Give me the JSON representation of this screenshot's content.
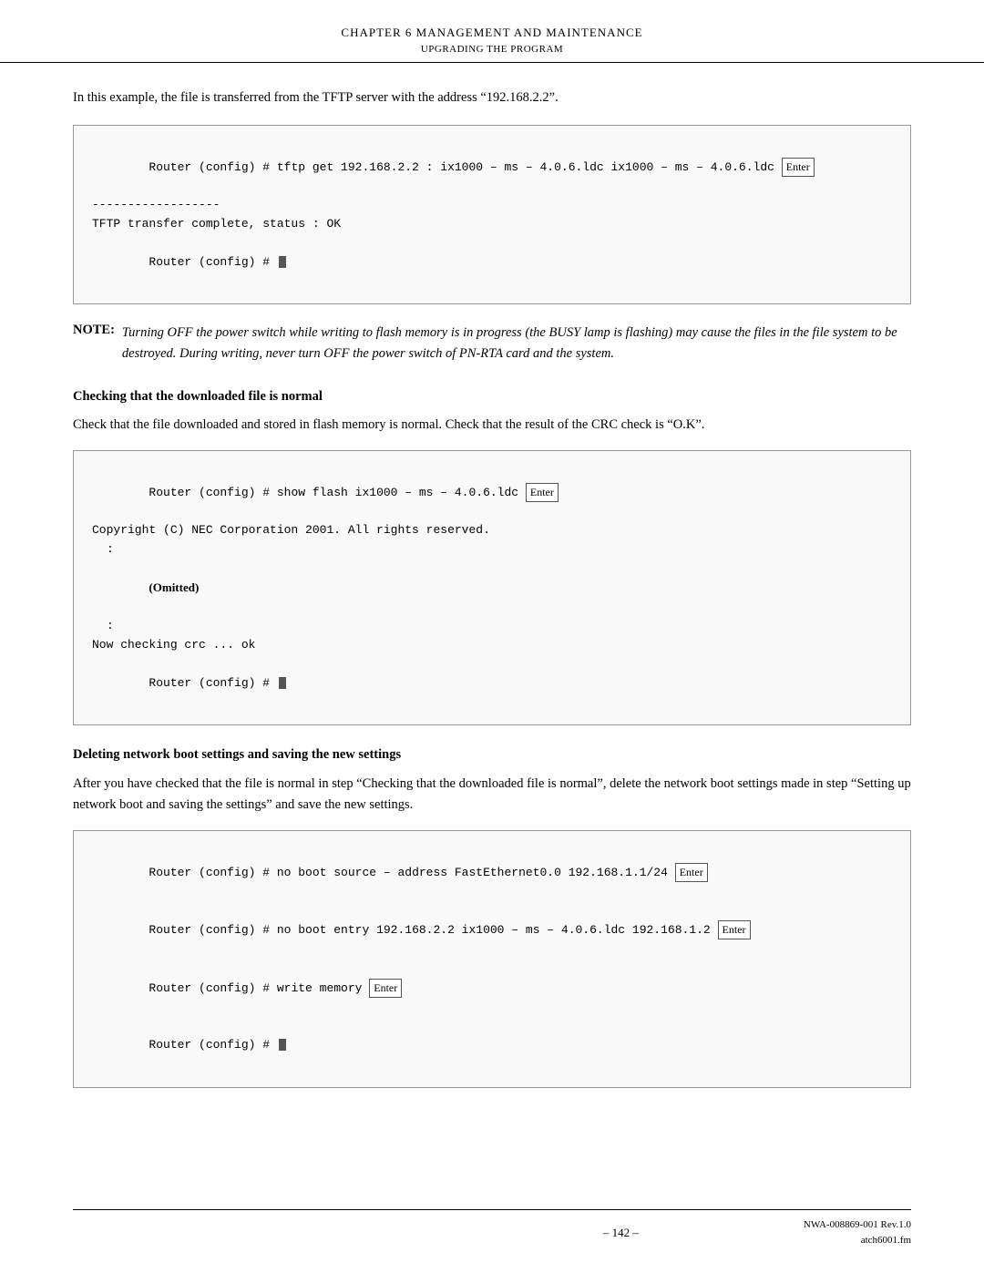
{
  "header": {
    "chapter": "CHAPTER 6   MANAGEMENT AND MAINTENANCE",
    "subtitle": "UPGRADING THE PROGRAM",
    "rule": true
  },
  "intro": {
    "text": "In this example, the file is transferred from the TFTP server with the address “192.168.2.2”."
  },
  "code_block_1": {
    "line1": "Router (config) # tftp get 192.168.2.2 : ix1000 – ms – 4.0.6.ldc ix1000 – ms – 4.0.6.ldc ",
    "enter1": "Enter",
    "line2": "------------------",
    "line3": "TFTP transfer complete, status : OK",
    "line4": "Router (config) # "
  },
  "note": {
    "label": "NOTE:",
    "text": "Turning OFF the power switch while writing to flash memory is in progress (the BUSY lamp is flashing) may cause the files in the file system to be destroyed. During writing, never turn OFF the power switch of PN-RTA card and the system."
  },
  "section1": {
    "heading": "Checking that the downloaded file is normal",
    "body": "Check that the file downloaded and stored in flash memory is normal. Check that the result of the CRC check is “O.K”."
  },
  "code_block_2": {
    "line1": "Router (config) # show flash ix1000 – ms – 4.0.6.ldc ",
    "enter1": "Enter",
    "line2": "Copyright (C) NEC Corporation 2001. All rights reserved.",
    "colon1": ":",
    "omitted": "(Omitted)",
    "colon2": ":",
    "line3": "Now checking crc ... ok",
    "line4": "Router (config) # "
  },
  "section2": {
    "heading": "Deleting network boot settings and saving the new settings",
    "body": "After you have checked that the file is normal in step “Checking that the downloaded file is normal”, delete the network boot settings made in step “Setting up network boot and saving the settings” and save the new settings."
  },
  "code_block_3": {
    "line1": "Router (config) # no boot source – address FastEthernet0.0 192.168.1.1/24 ",
    "enter1": "Enter",
    "line2": "Router (config) # no boot entry 192.168.2.2 ix1000 – ms – 4.0.6.ldc 192.168.1.2 ",
    "enter2": "Enter",
    "line3": "Router (config) # write memory ",
    "enter3": "Enter",
    "line4": "Router (config) # "
  },
  "footer": {
    "page_number": "– 142 –",
    "doc_ref_line1": "NWA-008869-001 Rev.1.0",
    "doc_ref_line2": "atch6001.fm"
  }
}
